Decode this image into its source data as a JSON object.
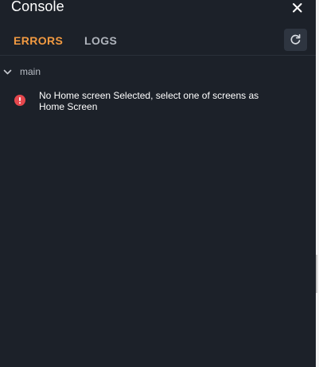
{
  "console": {
    "title": "Console",
    "tabs": [
      {
        "label": "ERRORS",
        "active": true
      },
      {
        "label": "LOGS",
        "active": false
      }
    ],
    "groups": [
      {
        "label": "main",
        "expanded": true,
        "errors": [
          {
            "message": "No Home screen Selected, select one of screens as Home Screen"
          }
        ]
      }
    ]
  },
  "icons": {
    "close": "close-icon",
    "refresh": "refresh-icon",
    "chevron": "chevron-down-icon",
    "error": "error-icon"
  },
  "colors": {
    "panel_bg": "#1c2129",
    "active_tab": "#f29a41",
    "inactive_tab": "#aeb3bb",
    "error_red": "#e5474d",
    "button_bg": "#2e3540"
  }
}
